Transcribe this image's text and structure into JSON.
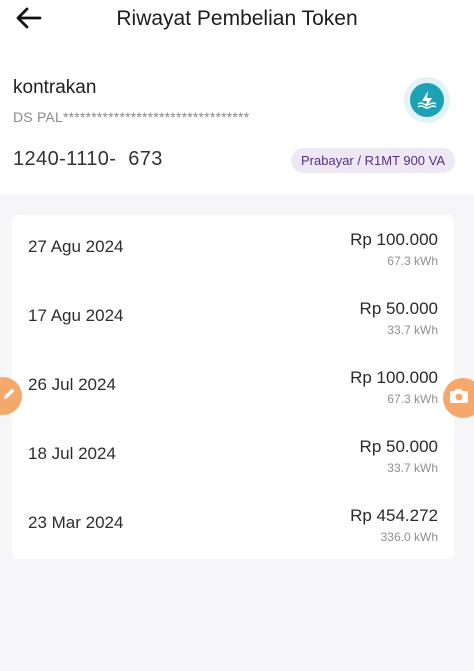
{
  "header": {
    "title": "Riwayat Pembelian Token",
    "back_icon": "arrow-left-icon"
  },
  "account": {
    "name": "kontrakan",
    "address": "DS PAL*********************************",
    "meter_number": "1240-1110-  673",
    "tariff": "Prabayar / R1MT 900 VA",
    "logo_icon": "pln-logo-icon"
  },
  "history": [
    {
      "date": "27 Agu 2024",
      "amount": "Rp 100.000",
      "kwh": "67.3 kWh"
    },
    {
      "date": "17 Agu 2024",
      "amount": "Rp 50.000",
      "kwh": "33.7 kWh"
    },
    {
      "date": "26 Jul 2024",
      "amount": "Rp 100.000",
      "kwh": "67.3 kWh"
    },
    {
      "date": "18 Jul 2024",
      "amount": "Rp 50.000",
      "kwh": "33.7 kWh"
    },
    {
      "date": "23 Mar 2024",
      "amount": "Rp 454.272",
      "kwh": "336.0 kWh"
    }
  ],
  "floating_buttons": {
    "left_icon": "pencil-icon",
    "right_icon": "camera-icon"
  },
  "colors": {
    "accent_orange": "#f5a86b",
    "pln_teal": "#1ba2b5",
    "badge_bg": "#eee8f4",
    "badge_text": "#5a2f7d"
  }
}
